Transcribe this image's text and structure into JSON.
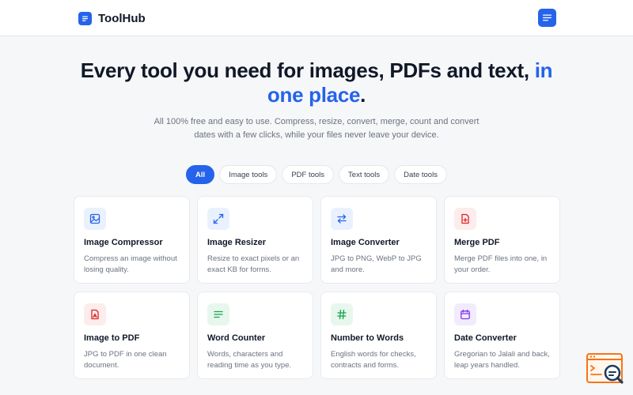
{
  "header": {
    "brand_name": "ToolHub",
    "brand_icon": "document-lines-icon",
    "menu_icon": "menu-icon"
  },
  "hero": {
    "title_main": "Every tool you need for images, PDFs and text,",
    "title_accent": "in one place",
    "title_end": ".",
    "subtitle": "All 100% free and easy to use. Compress, resize, convert, merge, count and convert dates with a few clicks, while your files never leave your device."
  },
  "filters": {
    "all": "All",
    "image": "Image tools",
    "pdf": "PDF tools",
    "text": "Text tools",
    "date": "Date tools",
    "active": "All"
  },
  "tools": [
    {
      "title": "Image Compressor",
      "desc": "Compress an image without losing quality.",
      "icon": "image-icon",
      "color": "#2563eb"
    },
    {
      "title": "Image Resizer",
      "desc": "Resize to exact pixels or an exact KB for forms.",
      "icon": "resize-arrows-icon",
      "color": "#2563eb"
    },
    {
      "title": "Image Converter",
      "desc": "JPG to PNG, WebP to JPG and more.",
      "icon": "swap-arrows-icon",
      "color": "#2563eb"
    },
    {
      "title": "Merge PDF",
      "desc": "Merge PDF files into one, in your order.",
      "icon": "file-plus-icon",
      "color": "#dc2626"
    },
    {
      "title": "Image to PDF",
      "desc": "JPG to PDF in one clean document.",
      "icon": "pdf-file-icon",
      "color": "#dc2626"
    },
    {
      "title": "Word Counter",
      "desc": "Words, characters and reading time as you type.",
      "icon": "text-lines-icon",
      "color": "#16a34a"
    },
    {
      "title": "Number to Words",
      "desc": "English words for checks, contracts and forms.",
      "icon": "hash-icon",
      "color": "#16a34a"
    },
    {
      "title": "Date Converter",
      "desc": "Gregorian to Jalali and back, leap years handled.",
      "icon": "calendar-icon",
      "color": "#7c3aed"
    }
  ],
  "colors": {
    "accent": "#2563eb",
    "pdf": "#dc2626",
    "text": "#16a34a",
    "date": "#7c3aed",
    "fab": "#f97316"
  },
  "fab_icon": "search-window-icon"
}
